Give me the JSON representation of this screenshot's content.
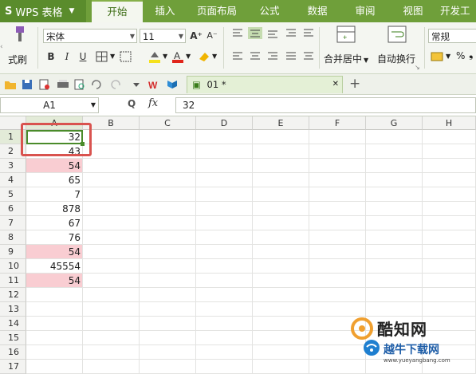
{
  "app": {
    "logo": "S",
    "name": "WPS 表格",
    "caret": "▼"
  },
  "tabs": [
    {
      "label": "开始",
      "active": true
    },
    {
      "label": "插入"
    },
    {
      "label": "页面布局"
    },
    {
      "label": "公式"
    },
    {
      "label": "数据"
    },
    {
      "label": "审阅"
    },
    {
      "label": "视图"
    },
    {
      "label": "开发工"
    }
  ],
  "ribbon": {
    "format_painter": "式刷",
    "font_name": "宋体",
    "font_size": "11",
    "grow": "A⁺",
    "shrink": "A⁻",
    "bold": "B",
    "italic": "I",
    "underline": "U",
    "merge_center": "合并居中",
    "merge_caret": "▼",
    "wrap_text": "自动换行",
    "number_format": "常规",
    "percent": "%",
    "comma": "❟"
  },
  "quick_access": {
    "doc_tab": "01 *",
    "close": "✕",
    "add": "+"
  },
  "formula_bar": {
    "name_box": "A1",
    "fx": "fx",
    "zoom_icon": "Q",
    "content": "32"
  },
  "columns": [
    "A",
    "B",
    "C",
    "D",
    "E",
    "F",
    "G",
    "H"
  ],
  "rows": [
    "1",
    "2",
    "3",
    "4",
    "5",
    "6",
    "7",
    "8",
    "9",
    "10",
    "11",
    "12",
    "13",
    "14",
    "15",
    "16",
    "17"
  ],
  "column_a_values": [
    "32",
    "43",
    "54",
    "65",
    "7",
    "878",
    "67",
    "76",
    "54",
    "45554",
    "54",
    "",
    "",
    "",
    "",
    "",
    ""
  ],
  "highlighted_rows": [
    3,
    9,
    11
  ],
  "colors": {
    "duplicate_fill": "#f9cdd2",
    "accent": "#6f9f3a",
    "selection": "#4a8b2a",
    "annotation": "#d9534f"
  },
  "watermark": {
    "line1": "酷知网",
    "line2": "越牛下载网",
    "line3": "www.yueyangbang.com"
  }
}
